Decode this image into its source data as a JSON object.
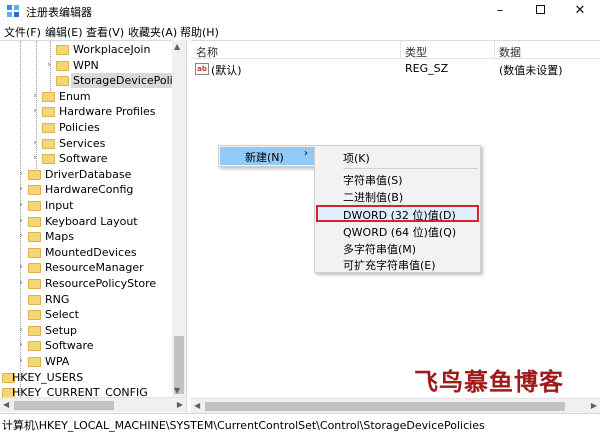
{
  "window": {
    "title": "注册表编辑器",
    "minimize": "–",
    "close": "✕"
  },
  "menu": [
    "文件(F)",
    "编辑(E)",
    "查看(V)",
    "收藏夹(A)",
    "帮助(H)"
  ],
  "tree": [
    {
      "label": "WorkplaceJoin",
      "expandable": false
    },
    {
      "label": "WPN",
      "expandable": true
    },
    {
      "label": "StorageDevicePolicies",
      "expandable": false,
      "selected": true
    },
    {
      "label": "Enum",
      "expandable": true
    },
    {
      "label": "Hardware Profiles",
      "expandable": true
    },
    {
      "label": "Policies",
      "expandable": false
    },
    {
      "label": "Services",
      "expandable": true
    },
    {
      "label": "Software",
      "expandable": true
    },
    {
      "label": "DriverDatabase",
      "expandable": true
    },
    {
      "label": "HardwareConfig",
      "expandable": true
    },
    {
      "label": "Input",
      "expandable": true
    },
    {
      "label": "Keyboard Layout",
      "expandable": true
    },
    {
      "label": "Maps",
      "expandable": true
    },
    {
      "label": "MountedDevices",
      "expandable": false
    },
    {
      "label": "ResourceManager",
      "expandable": true
    },
    {
      "label": "ResourcePolicyStore",
      "expandable": true
    },
    {
      "label": "RNG",
      "expandable": false
    },
    {
      "label": "Select",
      "expandable": false
    },
    {
      "label": "Setup",
      "expandable": true
    },
    {
      "label": "Software",
      "expandable": true
    },
    {
      "label": "WPA",
      "expandable": true
    },
    {
      "label": "HKEY_USERS",
      "expandable": false,
      "hkey": true
    },
    {
      "label": "HKEY_CURRENT_CONFIG",
      "expandable": false,
      "hkey": true
    }
  ],
  "list": {
    "columns": [
      "名称",
      "类型",
      "数据"
    ],
    "rows": [
      {
        "icon": "ab",
        "name": "(默认)",
        "type": "REG_SZ",
        "data": "(数值未设置)"
      }
    ]
  },
  "context_menu": {
    "parent_item": "新建(N)",
    "submenu": [
      "项(K)",
      "字符串值(S)",
      "二进制值(B)",
      "DWORD (32 位)值(D)",
      "QWORD (64 位)值(Q)",
      "多字符串值(M)",
      "可扩充字符串值(E)"
    ]
  },
  "watermark": "飞鸟慕鱼博客",
  "status_path": "计算机\\HKEY_LOCAL_MACHINE\\SYSTEM\\CurrentControlSet\\Control\\StorageDevicePolicies",
  "colors": {
    "highlight_border": "#d9232a",
    "menu_hover": "#91c9f7",
    "watermark": "#a11a1a"
  }
}
